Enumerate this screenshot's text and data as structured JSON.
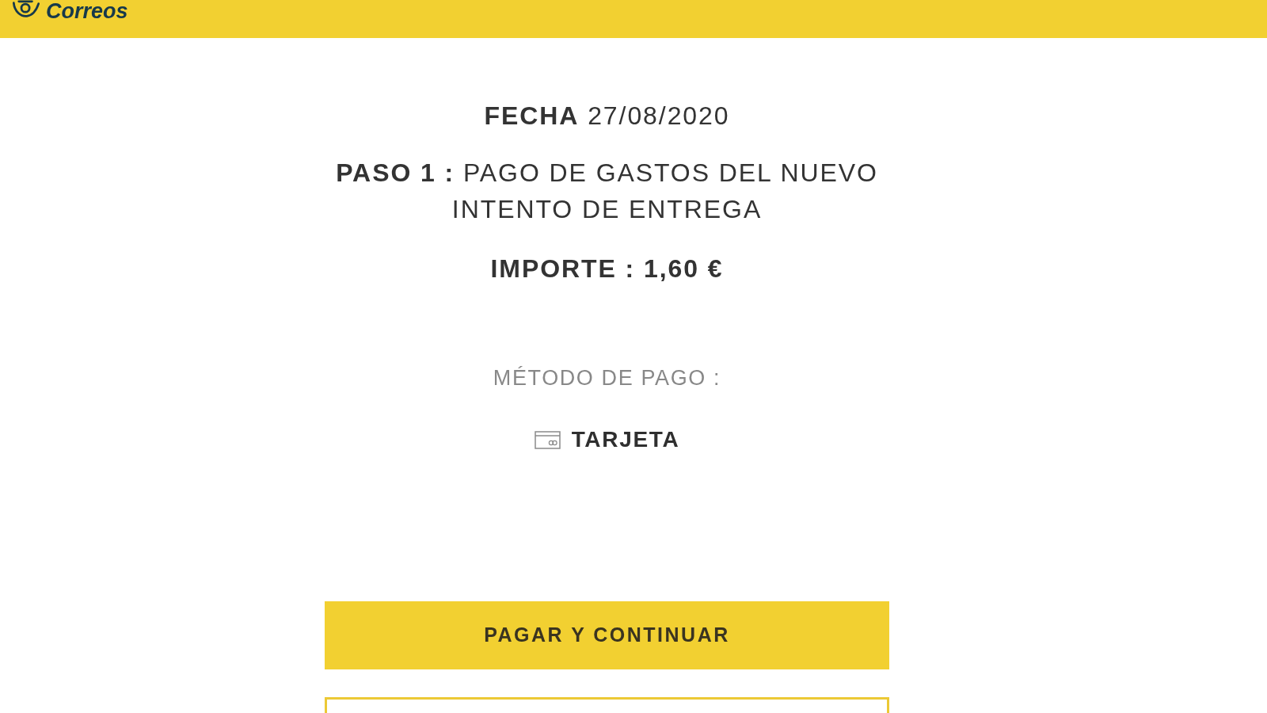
{
  "header": {
    "logo_text": "Correos"
  },
  "date_line": "**FECHA** 27/08/2020",
  "step_line": "**PASO 1 :** PAGO DE GASTOS DEL NUEVO INTENTO DE ENTREGA",
  "amount_line": "IMPORTE : 1,60 €",
  "payment_method": {
    "label": "MÉTODO DE PAGO :",
    "options": [
      {
        "kind": "card",
        "label": "TARJETA"
      }
    ]
  },
  "buttons": [
    {
      "kind": "primary",
      "label": "PAGAR Y CONTINUAR"
    },
    {
      "kind": "outline"
    }
  ]
}
